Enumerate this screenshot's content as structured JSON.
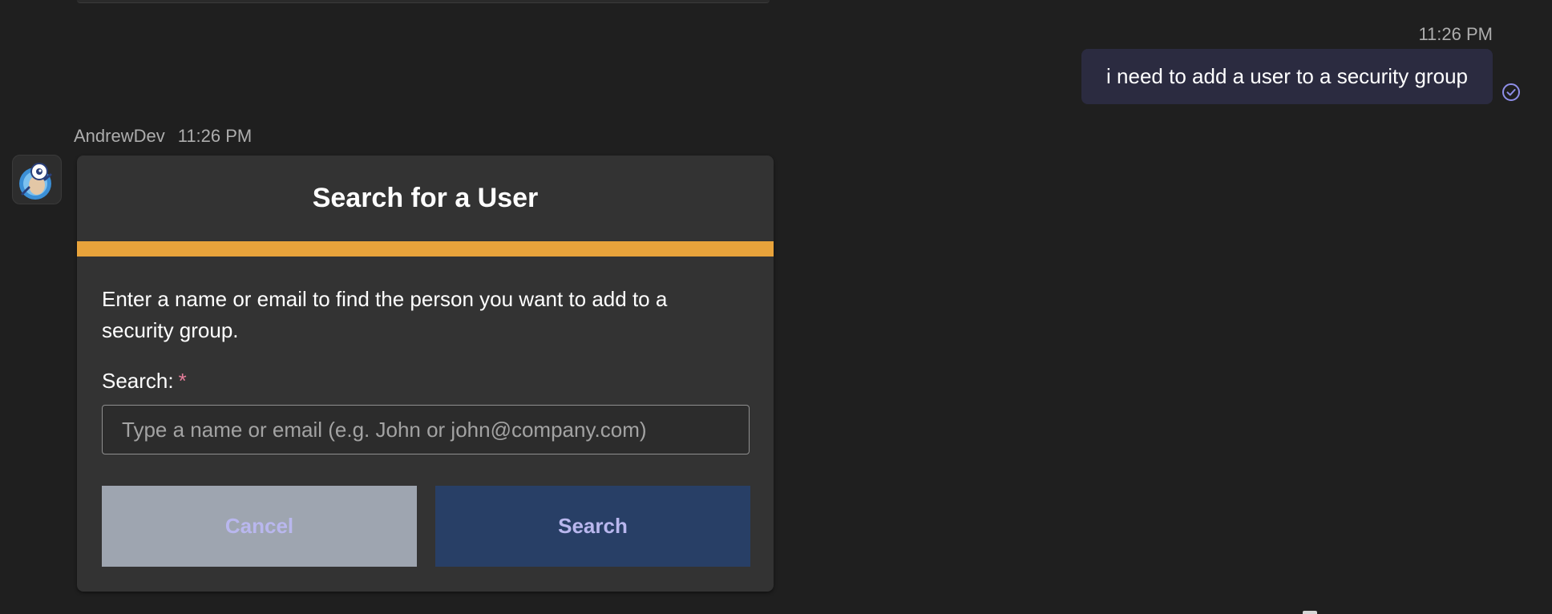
{
  "sent_message": {
    "timestamp": "11:26 PM",
    "text": "i need to add a user to a security group",
    "status_icon": "read-check-icon"
  },
  "bot_message": {
    "sender": "AndrewDev",
    "timestamp": "11:26 PM",
    "avatar_icon": "bot-avatar-icon",
    "card": {
      "title": "Search for a User",
      "accent_color": "#e8a33b",
      "description": "Enter a name or email to find the person you want to add to a security group.",
      "search_label": "Search:",
      "required_marker": "*",
      "search_placeholder": "Type a name or email (e.g. John or john@company.com)",
      "search_value": "",
      "cancel_label": "Cancel",
      "search_label_button": "Search"
    }
  },
  "colors": {
    "background": "#1f1f1f",
    "card": "#333333",
    "sent_bubble": "#2b2b40",
    "cancel_button": "#9ea5b0",
    "search_button": "#283f66",
    "button_text": "#b9b7ee",
    "required": "#e57d9a"
  }
}
